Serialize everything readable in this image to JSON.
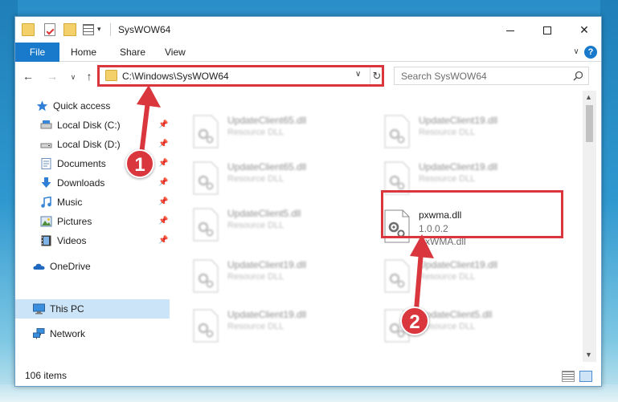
{
  "window": {
    "title": "SysWOW64"
  },
  "ribbon": {
    "file": "File",
    "home": "Home",
    "share": "Share",
    "view": "View",
    "help": "?"
  },
  "navbar": {
    "address": "C:\\Windows\\SysWOW64",
    "search_placeholder": "Search SysWOW64"
  },
  "sidebar": {
    "items": [
      {
        "label": "Quick access",
        "icon": "star-icon",
        "pinned": false
      },
      {
        "label": "Local Disk (C:)",
        "icon": "drive-icon",
        "pinned": true
      },
      {
        "label": "Local Disk (D:)",
        "icon": "drive-icon",
        "pinned": true
      },
      {
        "label": "Documents",
        "icon": "documents-icon",
        "pinned": true
      },
      {
        "label": "Downloads",
        "icon": "download-icon",
        "pinned": true
      },
      {
        "label": "Music",
        "icon": "music-icon",
        "pinned": true
      },
      {
        "label": "Pictures",
        "icon": "pictures-icon",
        "pinned": true
      },
      {
        "label": "Videos",
        "icon": "videos-icon",
        "pinned": true
      },
      {
        "label": "OneDrive",
        "icon": "cloud-icon",
        "pinned": false
      },
      {
        "label": "This PC",
        "icon": "computer-icon",
        "pinned": false
      },
      {
        "label": "Network",
        "icon": "network-icon",
        "pinned": false
      }
    ]
  },
  "files": {
    "left": [
      {
        "name": "UpdateClient65.dll",
        "type": "Resource DLL"
      },
      {
        "name": "UpdateClient65.dll",
        "type": "Resource DLL"
      },
      {
        "name": "UpdateClient5.dll",
        "type": "Resource DLL"
      },
      {
        "name": "UpdateClient19.dll",
        "type": "Resource DLL"
      },
      {
        "name": "UpdateClient19.dll",
        "type": "Resource DLL"
      }
    ],
    "right": [
      {
        "name": "UpdateClient19.dll",
        "type": "Resource DLL"
      },
      {
        "name": "UpdateClient19.dll",
        "type": "Resource DLL"
      },
      {
        "name": "UpdateClient19.dll",
        "type": "Resource DLL"
      },
      {
        "name": "UpdateClient5.dll",
        "type": "Resource DLL"
      }
    ],
    "highlighted": {
      "name": "pxwma.dll",
      "version": "1.0.0.2",
      "description": "PxWMA.dll"
    }
  },
  "status": {
    "item_count": "106 items"
  },
  "callouts": {
    "one": "1",
    "two": "2"
  },
  "colors": {
    "accent": "#1979ca",
    "highlight": "#d9363e",
    "selection": "#cce4f7"
  }
}
